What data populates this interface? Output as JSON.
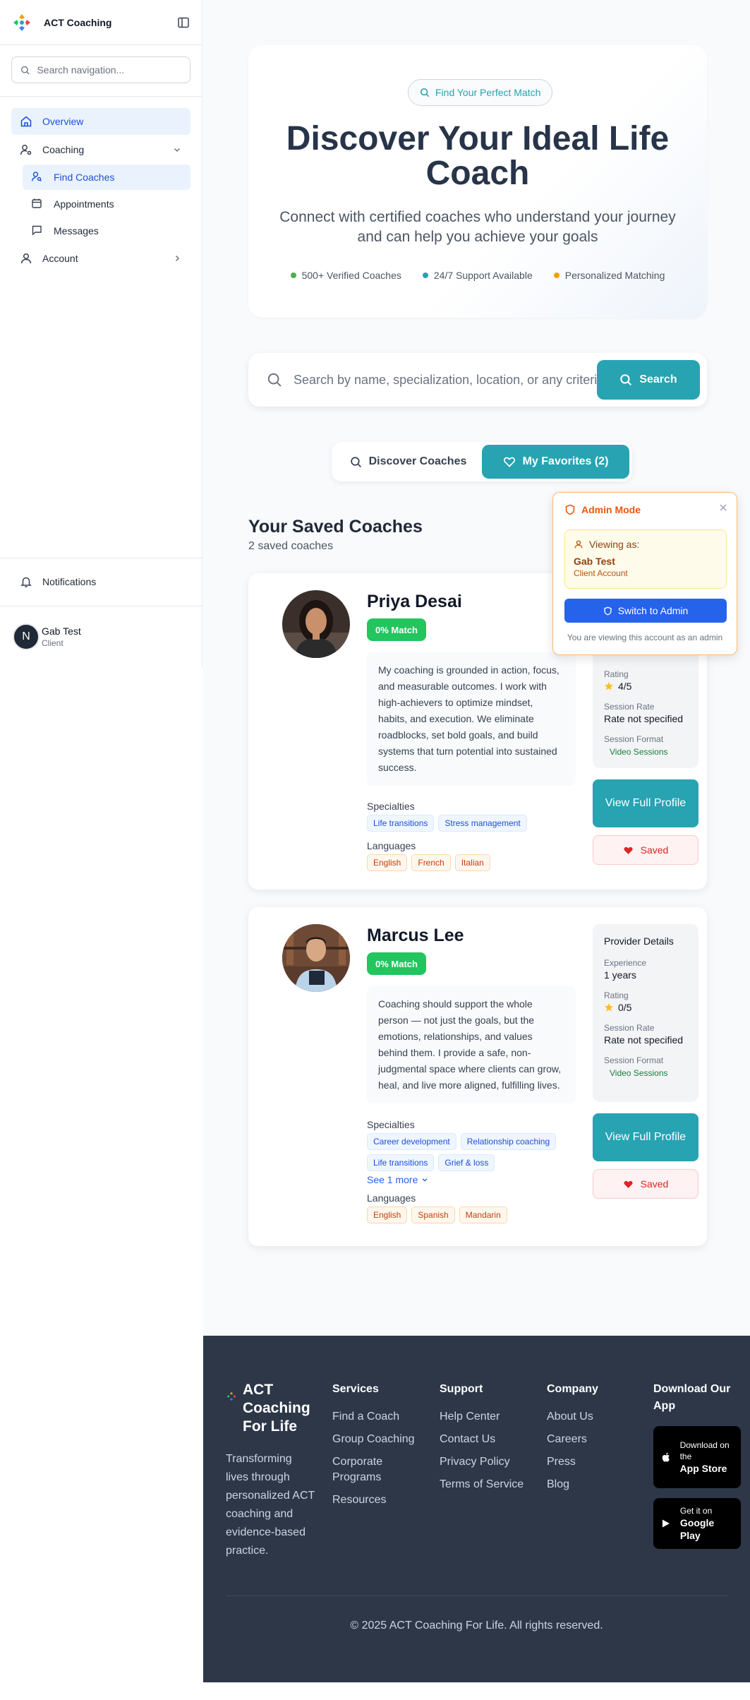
{
  "sidebar": {
    "brand": "ACT Coaching",
    "search_placeholder": "Search navigation...",
    "nav": {
      "overview": "Overview",
      "coaching": "Coaching",
      "find_coaches": "Find Coaches",
      "appointments": "Appointments",
      "messages": "Messages",
      "account": "Account"
    },
    "notifications": "Notifications",
    "user": {
      "initial": "N",
      "name": "Gab Test",
      "role": "Client"
    }
  },
  "hero": {
    "pill": "Find Your Perfect Match",
    "title": "Discover Your Ideal Life Coach",
    "subtitle": "Connect with certified coaches who understand your journey and can help you achieve your goals",
    "features": [
      {
        "label": "500+ Verified Coaches",
        "color": "#4caf50"
      },
      {
        "label": "24/7 Support Available",
        "color": "#27a3b2"
      },
      {
        "label": "Personalized Matching",
        "color": "#f59e0b"
      }
    ]
  },
  "search": {
    "placeholder": "Search by name, specialization, location, or any criteria...",
    "button": "Search"
  },
  "tabs": {
    "discover": "Discover Coaches",
    "favorites": "My Favorites (2)"
  },
  "saved": {
    "heading": "Your Saved Coaches",
    "count": "2 saved coaches"
  },
  "coaches": [
    {
      "name": "Priya Desai",
      "match": "0% Match",
      "bio": "My coaching is grounded in action, focus, and measurable outcomes. I work with high-achievers to optimize mindset, habits, and execution. We eliminate roadblocks, set bold goals, and build systems that turn potential into sustained success.",
      "specialties_label": "Specialties",
      "specialties": [
        "Life transitions",
        "Stress management"
      ],
      "languages_label": "Languages",
      "languages": [
        "English",
        "French",
        "Italian"
      ],
      "details": {
        "rating_label": "Rating",
        "rating": "4/5",
        "rate_label": "Session Rate",
        "rate": "Rate not specified",
        "format_label": "Session Format",
        "format": "Video Sessions"
      },
      "view_button": "View Full Profile",
      "saved_button": "Saved"
    },
    {
      "name": "Marcus Lee",
      "match": "0% Match",
      "bio": "Coaching should support the whole person — not just the goals, but the emotions, relationships, and values behind them. I provide a safe, non-judgmental space where clients can grow, heal, and live more aligned, fulfilling lives.",
      "specialties_label": "Specialties",
      "specialties": [
        "Career development",
        "Relationship coaching",
        "Life transitions",
        "Grief & loss"
      ],
      "see_more": "See 1 more",
      "languages_label": "Languages",
      "languages": [
        "English",
        "Spanish",
        "Mandarin"
      ],
      "details": {
        "title": "Provider Details",
        "experience_label": "Experience",
        "experience": "1 years",
        "rating_label": "Rating",
        "rating": "0/5",
        "rate_label": "Session Rate",
        "rate": "Rate not specified",
        "format_label": "Session Format",
        "format": "Video Sessions"
      },
      "view_button": "View Full Profile",
      "saved_button": "Saved"
    }
  ],
  "admin": {
    "title": "Admin Mode",
    "viewing_as": "Viewing as:",
    "name": "Gab Test",
    "account": "Client Account",
    "switch_button": "Switch to Admin",
    "note": "You are viewing this account as an admin"
  },
  "footer": {
    "brand": "ACT Coaching For Life",
    "description": "Transforming lives through personalized ACT coaching and evidence-based practice.",
    "services": {
      "heading": "Services",
      "links": [
        "Find a Coach",
        "Group Coaching",
        "Corporate Programs",
        "Resources"
      ]
    },
    "support": {
      "heading": "Support",
      "links": [
        "Help Center",
        "Contact Us",
        "Privacy Policy",
        "Terms of Service"
      ]
    },
    "company": {
      "heading": "Company",
      "links": [
        "About Us",
        "Careers",
        "Press",
        "Blog"
      ]
    },
    "download": {
      "heading": "Download Our App",
      "app_store_small": "Download on the",
      "app_store": "App Store",
      "google_small": "Get it on",
      "google": "Google Play"
    },
    "copyright": "© 2025 ACT Coaching For Life. All rights reserved."
  }
}
